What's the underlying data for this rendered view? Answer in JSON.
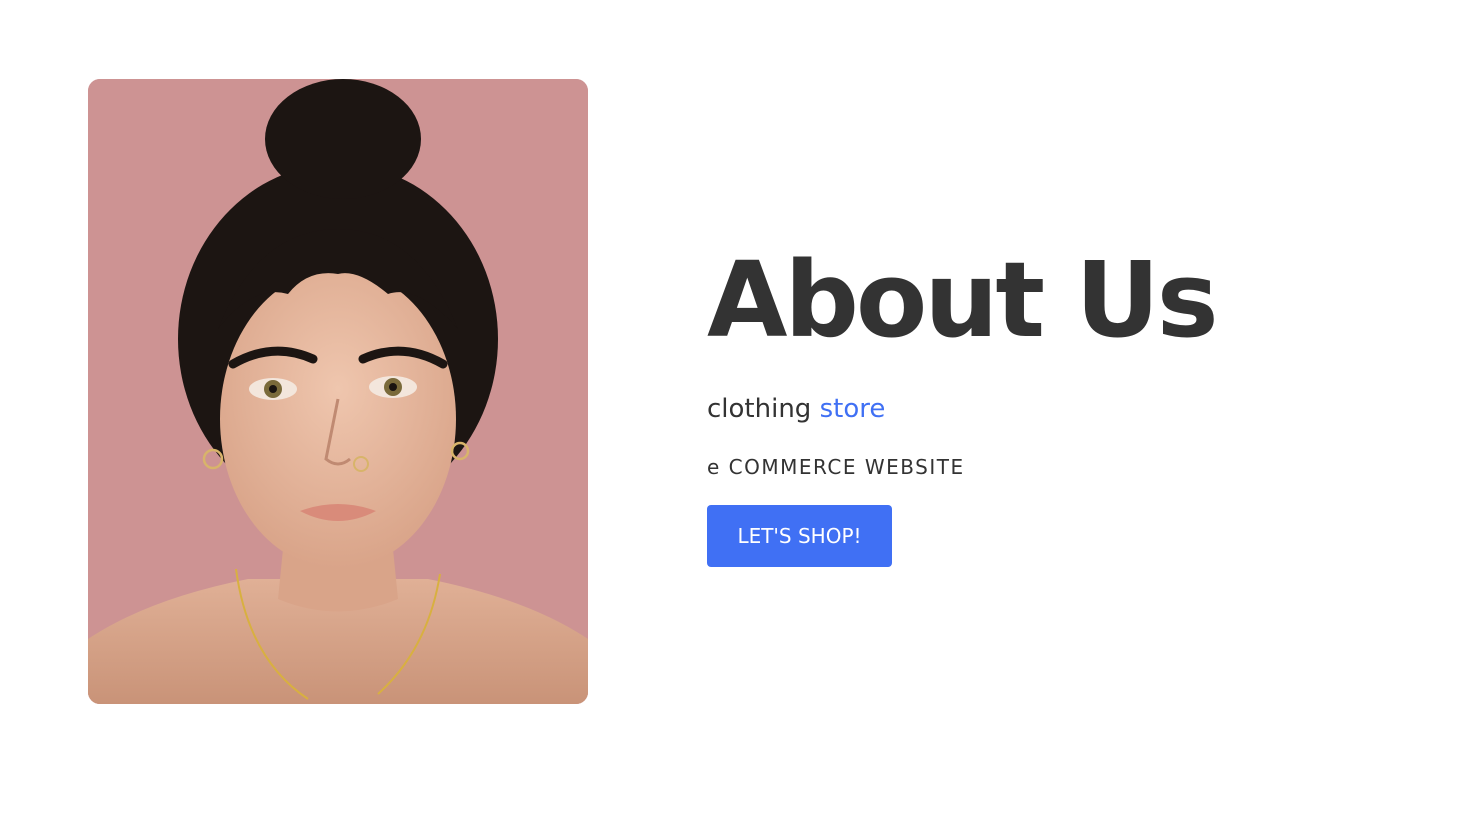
{
  "about": {
    "title": "About Us",
    "subtitle_main": "clothing",
    "subtitle_accent": "store",
    "tagline": "e COMMERCE WEBSITE",
    "cta_label": "LET'S SHOP!"
  },
  "photo": {
    "subject": "portrait-photo"
  },
  "colors": {
    "accent": "#4070f4",
    "text": "#333333",
    "photo_background": "#cd9393"
  }
}
